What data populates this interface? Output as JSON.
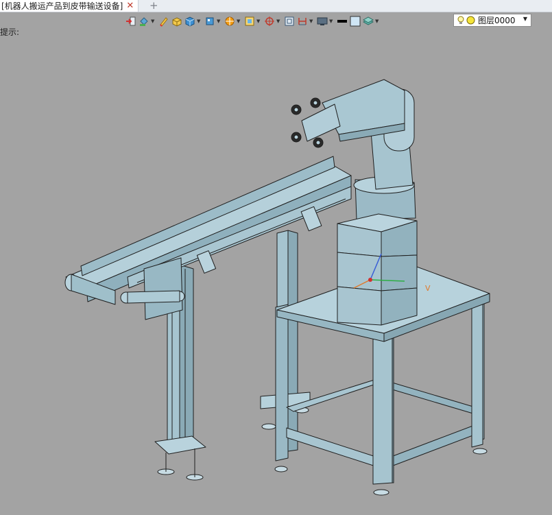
{
  "tab": {
    "title": "[机器人搬运产品到皮带输送设备]"
  },
  "prompt": {
    "text": "提示:"
  },
  "layer": {
    "name": "图层0000"
  },
  "axis": {
    "label": "V"
  },
  "colors": {
    "background": "#a3a3a3",
    "model": "#a9c8d4",
    "edge": "#1e1e1e",
    "accent": "#c0392b"
  },
  "toolbar_icons": [
    "exit-icon",
    "paint-bucket-icon",
    "pencil-icon",
    "box-yellow-icon",
    "cube-icon",
    "cube-style-icon",
    "color-wheel-icon",
    "picture-icon",
    "target-icon",
    "frame-icon",
    "dimension-icon",
    "display-icon",
    "line-color-icon",
    "fill-color-icon",
    "layer-stack-icon"
  ]
}
